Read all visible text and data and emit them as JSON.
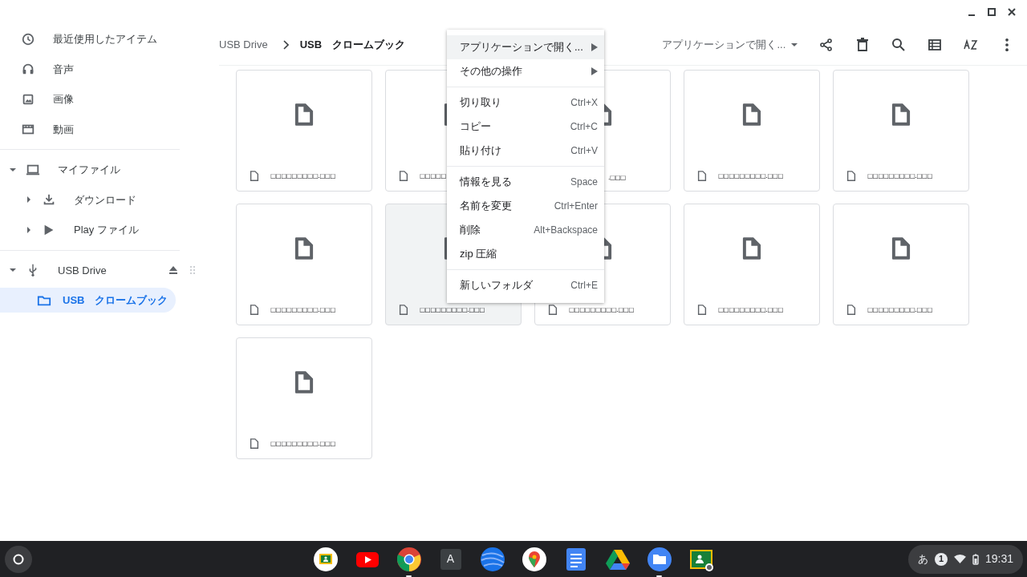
{
  "sidebar": {
    "items": [
      {
        "label": "最近使用したアイテム",
        "kind": "recent",
        "selected": false
      },
      {
        "label": "音声",
        "kind": "audio",
        "selected": false
      },
      {
        "label": "画像",
        "kind": "images",
        "selected": false
      },
      {
        "label": "動画",
        "kind": "videos",
        "selected": false
      },
      {
        "kind": "divider"
      },
      {
        "label": "マイファイル",
        "kind": "my_files",
        "expanded": true,
        "selected": false,
        "children": [
          {
            "label": "ダウンロード",
            "kind": "downloads",
            "expanded": false,
            "selected": false
          },
          {
            "label": "Play ファイル",
            "kind": "play_files",
            "expanded": false,
            "selected": false
          }
        ]
      },
      {
        "kind": "divider"
      },
      {
        "label": "USB Drive",
        "kind": "removable",
        "expanded": true,
        "eject": true,
        "selected": false,
        "children": [
          {
            "label": "USB　クロームブック",
            "kind": "folder",
            "selected": true
          }
        ]
      }
    ]
  },
  "breadcrumb": [
    "USB Drive",
    "USB　クロームブック"
  ],
  "toolbar": {
    "open_with": "アプリケーションで開く..."
  },
  "files": [
    {
      "name": "□□□□□□□□□.□□□",
      "selected": false
    },
    {
      "name": "□□□□□",
      "selected": false
    },
    {
      "name": ".□□□",
      "selected": false,
      "clipped": true
    },
    {
      "name": "□□□□□□□□□.□□□",
      "selected": false
    },
    {
      "name": "□□□□□□□□□.□□□",
      "selected": false
    },
    {
      "name": "□□□□□□□□□.□□□",
      "selected": false
    },
    {
      "name": "□□□□□□□□□.□□□",
      "selected": true
    },
    {
      "name": "□□□□□□□□□.□□□",
      "selected": false
    },
    {
      "name": "□□□□□□□□□.□□□",
      "selected": false
    },
    {
      "name": "□□□□□□□□□.□□□",
      "selected": false
    },
    {
      "name": "□□□□□□□□□.□□□",
      "selected": false
    }
  ],
  "context_menu": [
    {
      "label": "アプリケーションで開く...",
      "submenu": true,
      "selected": true
    },
    {
      "label": "その他の操作",
      "submenu": true,
      "selected": false
    },
    {
      "kind": "divider"
    },
    {
      "label": "切り取り",
      "shortcut": "Ctrl+X",
      "selected": false
    },
    {
      "label": "コピー",
      "shortcut": "Ctrl+C",
      "selected": false
    },
    {
      "label": "貼り付け",
      "shortcut": "Ctrl+V",
      "selected": false
    },
    {
      "kind": "divider"
    },
    {
      "label": "情報を見る",
      "shortcut": "Space",
      "selected": false
    },
    {
      "label": "名前を変更",
      "shortcut": "Ctrl+Enter",
      "selected": false
    },
    {
      "label": "削除",
      "shortcut": "Alt+Backspace",
      "selected": false
    },
    {
      "label": "zip 圧縮",
      "selected": false
    },
    {
      "kind": "divider"
    },
    {
      "label": "新しいフォルダ",
      "shortcut": "Ctrl+E",
      "selected": false
    }
  ],
  "shelf": {
    "apps": [
      {
        "kind": "classroom",
        "running": false
      },
      {
        "kind": "youtube",
        "running": false
      },
      {
        "kind": "chrome",
        "running": true
      },
      {
        "kind": "letter",
        "label": "A",
        "running": false
      },
      {
        "kind": "earth",
        "running": false
      },
      {
        "kind": "maps",
        "running": false
      },
      {
        "kind": "docs",
        "running": false
      },
      {
        "kind": "drive",
        "running": false
      },
      {
        "kind": "files",
        "running": true
      },
      {
        "kind": "classroom_badge",
        "running": false
      }
    ],
    "status": {
      "ime": "あ",
      "notifications": "1",
      "time": "19:31"
    }
  }
}
